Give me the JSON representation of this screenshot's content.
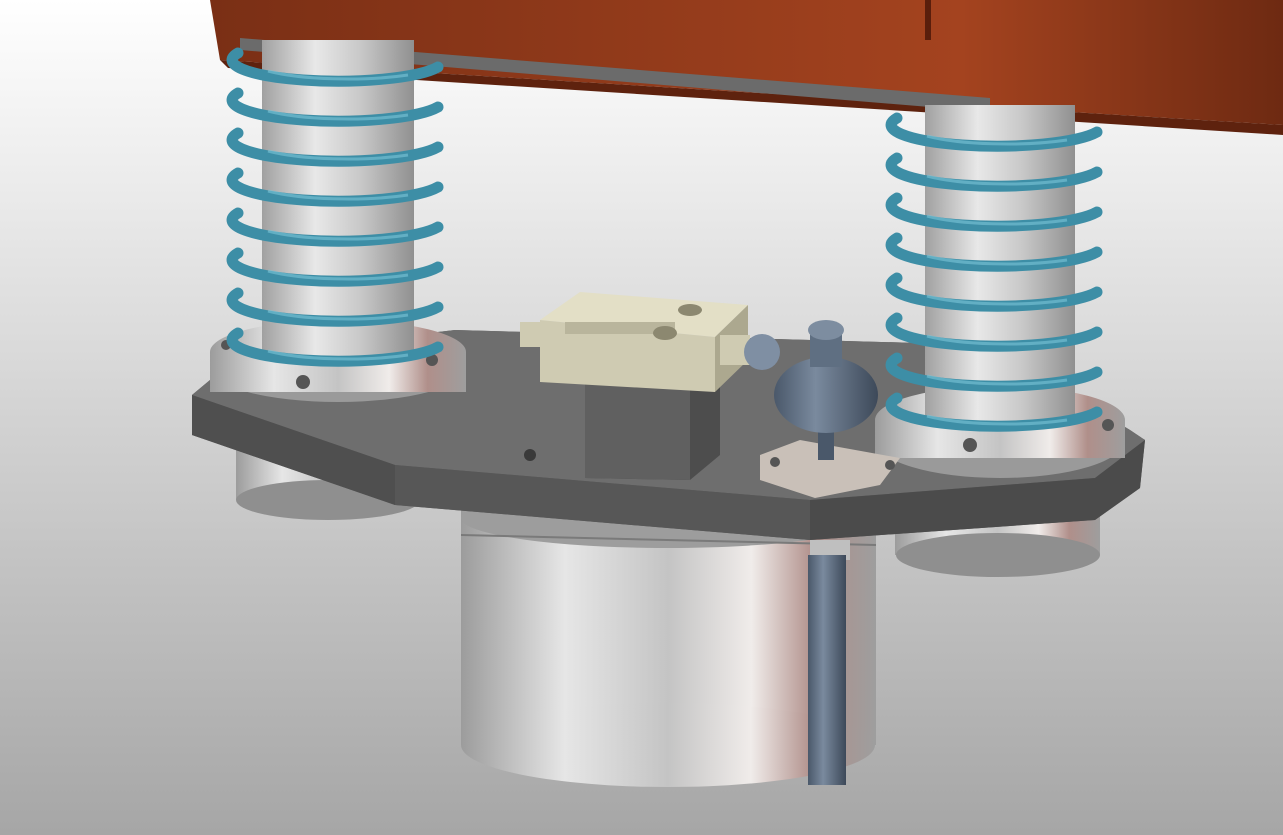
{
  "viewport": {
    "background_top": "#ffffff",
    "background_bottom": "#a6a6a6"
  },
  "colors": {
    "frame": "#8a3a1c",
    "frame_dark": "#5e220e",
    "spring": "#3d8ea6",
    "spring_highlight": "#7cc4d8",
    "plate": "#5c5c5c",
    "plate_top": "#6b6b6b",
    "plate_edge": "#4a4a4a",
    "steel_light": "#e8e8e8",
    "steel_mid": "#b9b9b9",
    "steel_dark": "#8d8d8d",
    "sensor_body": "#cfcbb2",
    "sensor_dark": "#a9a58c",
    "valve": "#5f6f82",
    "valve_dark": "#3f4c5c"
  },
  "parts": [
    {
      "name": "frame",
      "icon": "frame-beam-icon"
    },
    {
      "name": "spring-left",
      "icon": "coil-spring-icon"
    },
    {
      "name": "spring-right",
      "icon": "coil-spring-icon"
    },
    {
      "name": "mount-plate",
      "icon": "plate-icon"
    },
    {
      "name": "cylinder",
      "icon": "cylinder-icon"
    },
    {
      "name": "sensor",
      "icon": "sensor-icon"
    },
    {
      "name": "valve",
      "icon": "valve-icon"
    }
  ]
}
